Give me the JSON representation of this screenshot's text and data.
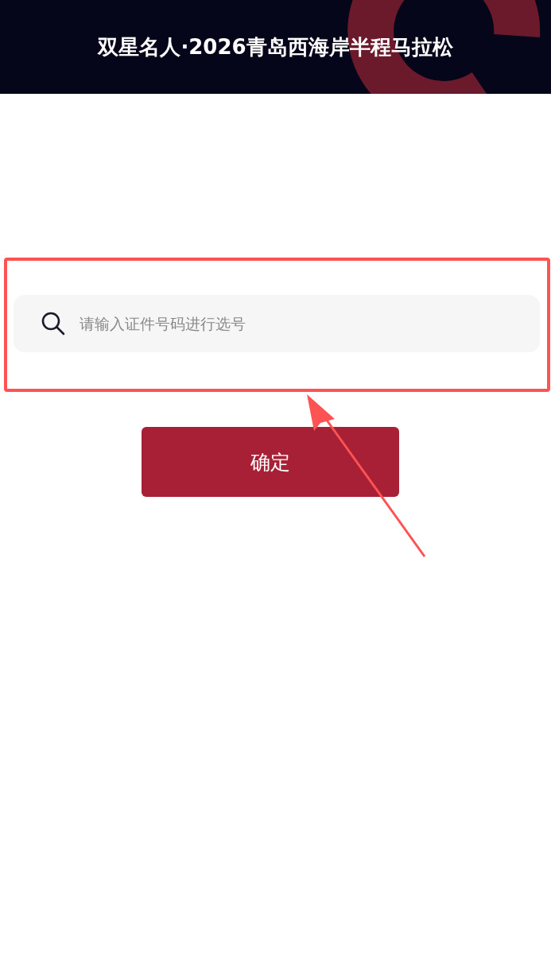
{
  "header": {
    "title": "双星名人·2026青岛西海岸半程马拉松"
  },
  "search": {
    "placeholder": "请输入证件号码进行选号"
  },
  "confirm_button": {
    "label": "确定"
  }
}
